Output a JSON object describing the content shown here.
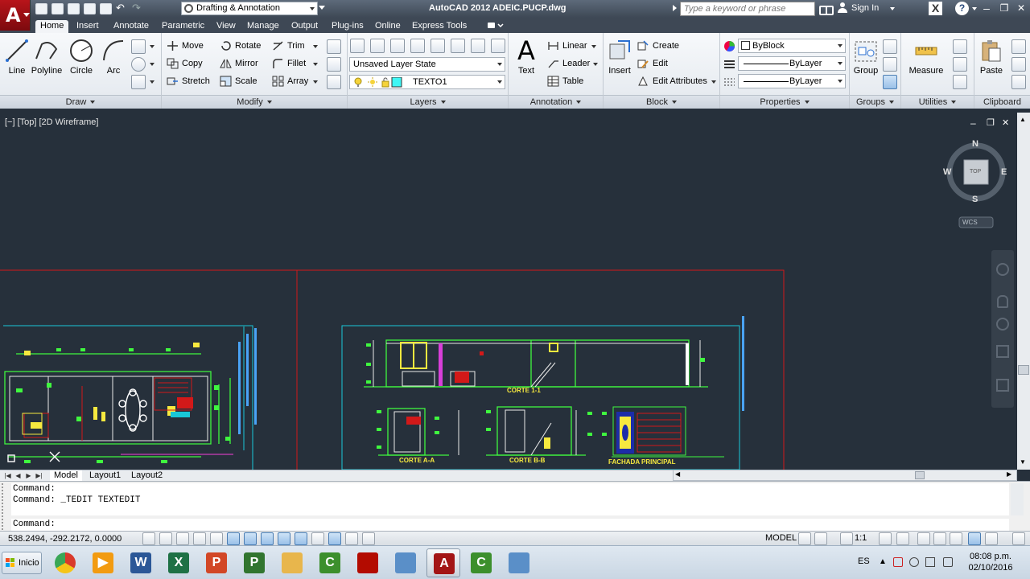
{
  "titlebar": {
    "app_title": "AutoCAD 2012   ADEIC.PUCP.dwg",
    "workspace": "Drafting & Annotation",
    "search_placeholder": "Type a keyword or phrase",
    "sign_in": "Sign In",
    "exchange_label": "X",
    "help_label": "?",
    "min_label": "–",
    "restore_label": "❐",
    "close_label": "✕"
  },
  "tabs": [
    "Home",
    "Insert",
    "Annotate",
    "Parametric",
    "View",
    "Manage",
    "Output",
    "Plug-ins",
    "Online",
    "Express Tools"
  ],
  "ribbon": {
    "draw": {
      "title": "Draw",
      "line": "Line",
      "polyline": "Polyline",
      "circle": "Circle",
      "arc": "Arc"
    },
    "modify": {
      "title": "Modify",
      "move": "Move",
      "rotate": "Rotate",
      "trim": "Trim",
      "copy": "Copy",
      "mirror": "Mirror",
      "fillet": "Fillet",
      "stretch": "Stretch",
      "scale": "Scale",
      "array": "Array"
    },
    "layers": {
      "title": "Layers",
      "layer_state": "Unsaved Layer State",
      "current_layer": "TEXTO1"
    },
    "annotation": {
      "title": "Annotation",
      "text": "Text",
      "linear": "Linear",
      "leader": "Leader",
      "table": "Table"
    },
    "block": {
      "title": "Block",
      "insert": "Insert",
      "create": "Create",
      "edit": "Edit",
      "edit_attributes": "Edit Attributes"
    },
    "properties": {
      "title": "Properties",
      "color": "ByBlock",
      "linetype": "ByLayer",
      "lineweight": "ByLayer"
    },
    "groups": {
      "title": "Groups",
      "group": "Group"
    },
    "utilities": {
      "title": "Utilities",
      "measure": "Measure"
    },
    "clipboard": {
      "title": "Clipboard",
      "paste": "Paste"
    }
  },
  "viewport": {
    "label": "[−] [Top] [2D Wireframe]",
    "minimize": "–",
    "restore": "❐",
    "close": "✕",
    "viewcube": {
      "n": "N",
      "s": "S",
      "e": "E",
      "w": "W",
      "top": "TOP",
      "wcs": "WCS"
    },
    "drawing_labels": {
      "corte_11": "CORTE 1-1",
      "corte_aa": "CORTE A-A",
      "corte_bb": "CORTE B-B",
      "fachada": "FACHADA PRINCIPAL"
    }
  },
  "layout_tabs": [
    "Model",
    "Layout1",
    "Layout2"
  ],
  "command": {
    "history": [
      "Command:",
      "Command: _TEDIT TEXTEDIT"
    ],
    "prompt": "Command:"
  },
  "status": {
    "coordinates": "538.2494, -292.2172, 0.0000",
    "model": "MODEL",
    "scale": "1:1"
  },
  "taskbar": {
    "start": "Inicio",
    "language": "ES",
    "time": "08:08 p.m.",
    "date": "02/10/2016",
    "apps": [
      {
        "name": "chrome",
        "color": "#d93a2b",
        "glyph": ""
      },
      {
        "name": "media-player",
        "color": "#f29b11",
        "glyph": "▶"
      },
      {
        "name": "word",
        "color": "#2b5797",
        "glyph": "W"
      },
      {
        "name": "excel",
        "color": "#1e7145",
        "glyph": "X"
      },
      {
        "name": "powerpoint",
        "color": "#d24726",
        "glyph": "P"
      },
      {
        "name": "project",
        "color": "#31752f",
        "glyph": "P"
      },
      {
        "name": "explorer",
        "color": "#e8b64c",
        "glyph": ""
      },
      {
        "name": "camtasia",
        "color": "#3c8f2c",
        "glyph": "C"
      },
      {
        "name": "acrobat",
        "color": "#b30b00",
        "glyph": ""
      },
      {
        "name": "picture-viewer",
        "color": "#5a8fc8",
        "glyph": ""
      },
      {
        "name": "autocad",
        "color": "#a31515",
        "glyph": "A"
      },
      {
        "name": "camtasia-recorder",
        "color": "#3c8f2c",
        "glyph": "C"
      },
      {
        "name": "picture-viewer-2",
        "color": "#5a8fc8",
        "glyph": ""
      }
    ]
  }
}
